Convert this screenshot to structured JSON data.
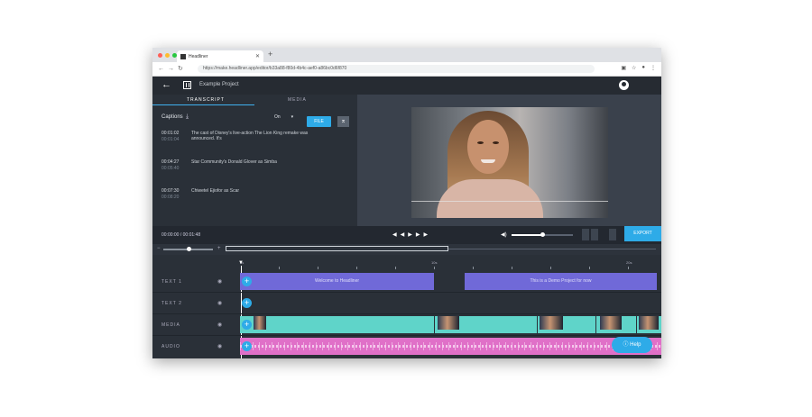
{
  "browser": {
    "tab_title": "Headliner",
    "url": "https://make.headliner.app/editor/b33a88-f80d-4b4c-aef0-a86bc0d6f870"
  },
  "app": {
    "project_title": "Example Project"
  },
  "left_panel": {
    "tabs": [
      "TRANSCRIPT",
      "MEDIA"
    ],
    "captions_label": "Captions",
    "captions_toggle_value": "On",
    "file_button_label": "FILE",
    "entries": [
      {
        "time": "00:01:02",
        "end": "00:01:04",
        "text": "The cast of Disney's live-action The Lion King remake was announced. It's"
      },
      {
        "time": "00:04:27",
        "end": "00:05:40",
        "text": "Star Community's Donald Glover as Simba"
      },
      {
        "time": "00:07:30",
        "end": "00:08:20",
        "text": "Chiwetel Ejiofor as Scar"
      }
    ]
  },
  "controls": {
    "timecode": "00:00:00 / 00:01:48",
    "export_label": "EXPORT"
  },
  "timeline": {
    "ruler_labels": [
      "0s",
      "10s",
      "20s"
    ],
    "rows": [
      {
        "label": "TEXT 1"
      },
      {
        "label": "TEXT 2"
      },
      {
        "label": "MEDIA"
      },
      {
        "label": "AUDIO"
      }
    ],
    "text_clips": [
      "Welcome to Headliner",
      "This is a Demo Project for now"
    ],
    "help_label": "Help"
  },
  "colors": {
    "accent": "#2eabe8",
    "text_clip": "#7069d8",
    "media_clip": "#5fd4c9",
    "audio_clip": "#e070c8"
  }
}
